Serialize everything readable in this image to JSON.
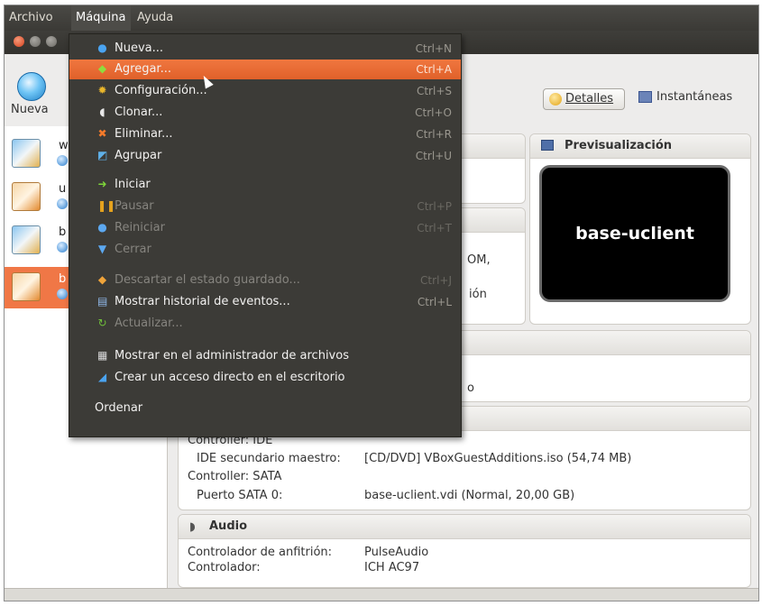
{
  "menubar": {
    "items": [
      "Archivo",
      "Máquina",
      "Ayuda"
    ]
  },
  "toolbar": {
    "new_label": "Nueva",
    "details_label": "Detalles",
    "snapshots_label": "Instantáneas"
  },
  "vm_list": [
    {
      "name": "w",
      "icon": "windows-7-icon",
      "selected": false
    },
    {
      "name": "u",
      "icon": "ubuntu-icon",
      "selected": false
    },
    {
      "name": "b",
      "icon": "windows-7-icon",
      "selected": false
    },
    {
      "name": "b",
      "icon": "ubuntu-icon",
      "selected": true
    }
  ],
  "menu": {
    "items": [
      {
        "label": "Nueva...",
        "shortcut": "Ctrl+N",
        "icon": "new-icon",
        "enabled": true,
        "highlighted": false
      },
      {
        "label": "Agregar...",
        "shortcut": "Ctrl+A",
        "icon": "add-icon",
        "enabled": true,
        "highlighted": true
      },
      {
        "label": "Configuración...",
        "shortcut": "Ctrl+S",
        "icon": "settings-icon",
        "enabled": true,
        "highlighted": false
      },
      {
        "label": "Clonar...",
        "shortcut": "Ctrl+O",
        "icon": "clone-icon",
        "enabled": true,
        "highlighted": false
      },
      {
        "label": "Eliminar...",
        "shortcut": "Ctrl+R",
        "icon": "delete-icon",
        "enabled": true,
        "highlighted": false
      },
      {
        "label": "Agrupar",
        "shortcut": "Ctrl+U",
        "icon": "group-icon",
        "enabled": true,
        "highlighted": false
      },
      {
        "label": "Iniciar",
        "shortcut": "",
        "icon": "start-icon",
        "enabled": true,
        "highlighted": false
      },
      {
        "label": "Pausar",
        "shortcut": "Ctrl+P",
        "icon": "pause-icon",
        "enabled": false,
        "highlighted": false
      },
      {
        "label": "Reiniciar",
        "shortcut": "Ctrl+T",
        "icon": "reset-icon",
        "enabled": false,
        "highlighted": false
      },
      {
        "label": "Cerrar",
        "shortcut": "",
        "icon": "close-icon",
        "enabled": false,
        "highlighted": false
      },
      {
        "label": "Descartar el estado guardado...",
        "shortcut": "Ctrl+J",
        "icon": "discard-icon",
        "enabled": false,
        "highlighted": false
      },
      {
        "label": "Mostrar historial de eventos...",
        "shortcut": "Ctrl+L",
        "icon": "log-icon",
        "enabled": true,
        "highlighted": false
      },
      {
        "label": "Actualizar...",
        "shortcut": "",
        "icon": "refresh-icon",
        "enabled": false,
        "highlighted": false
      },
      {
        "label": "Mostrar en el administrador de archivos",
        "shortcut": "",
        "icon": "file-manager-icon",
        "enabled": true,
        "highlighted": false
      },
      {
        "label": "Crear un acceso directo en el escritorio",
        "shortcut": "",
        "icon": "shortcut-icon",
        "enabled": true,
        "highlighted": false
      },
      {
        "label": "Ordenar",
        "shortcut": "",
        "icon": "",
        "enabled": true,
        "highlighted": false
      }
    ]
  },
  "details": {
    "preview_title": "Previsualización",
    "preview_vm_name": "base-uclient",
    "partial_text_1": "OM,",
    "partial_text_2": "ión",
    "partial_text_3": "o",
    "storage": {
      "controller_ide": "Controller: IDE",
      "ide_secondary_label": "IDE secundario maestro:",
      "ide_secondary_value": "[CD/DVD] VBoxGuestAdditions.iso (54,74 MB)",
      "controller_sata": "Controller: SATA",
      "sata_port_label": "Puerto SATA 0:",
      "sata_port_value": "base-uclient.vdi (Normal, 20,00 GB)"
    },
    "audio": {
      "title": "Audio",
      "host_driver_label": "Controlador de anfitrión:",
      "host_driver_value": "PulseAudio",
      "controller_label": "Controlador:",
      "controller_value": "ICH AC97"
    }
  },
  "colors": {
    "highlight": "#f07746",
    "menu_bg": "#3c3b37",
    "selected_row": "#f07746"
  }
}
